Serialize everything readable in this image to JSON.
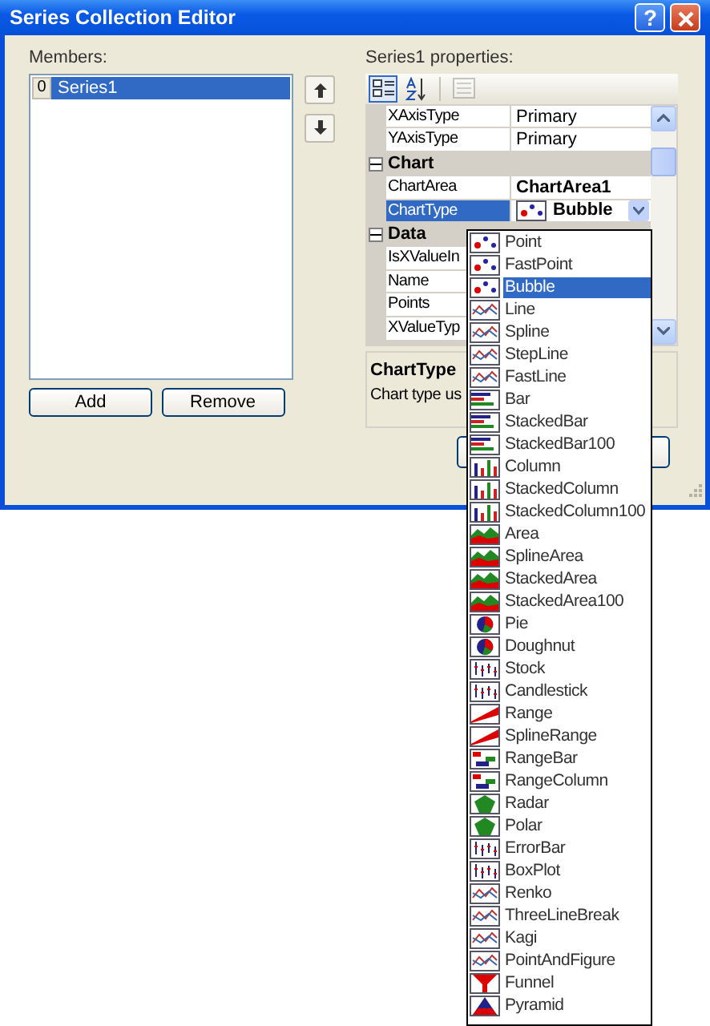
{
  "window": {
    "title": "Series Collection Editor",
    "help": "?"
  },
  "members": {
    "label": "Members:",
    "items": [
      {
        "index": "0",
        "name": "Series1",
        "selected": true
      }
    ],
    "add": "Add",
    "remove": "Remove"
  },
  "properties": {
    "label": "Series1 properties:",
    "toolbar": [
      {
        "kind": "categorized",
        "selected": true,
        "disabled": false
      },
      {
        "kind": "alphabetical",
        "selected": false,
        "disabled": false
      },
      {
        "kind": "pages",
        "selected": false,
        "disabled": true
      }
    ],
    "rows": [
      {
        "kind": "property",
        "name": "XAxisType",
        "value": "Primary",
        "selected": false,
        "modified": false
      },
      {
        "kind": "property",
        "name": "YAxisType",
        "value": "Primary",
        "selected": false,
        "modified": false
      },
      {
        "kind": "category",
        "name": "Chart",
        "expanded": true
      },
      {
        "kind": "property",
        "name": "ChartArea",
        "value": "ChartArea1",
        "selected": false,
        "modified": true
      },
      {
        "kind": "dropdown",
        "name": "ChartType",
        "value": "Bubble",
        "selected": true,
        "modified": true
      },
      {
        "kind": "category",
        "name": "Data",
        "expanded": true
      },
      {
        "kind": "property",
        "name": "IsXValueIn",
        "selected": false
      },
      {
        "kind": "property",
        "name": "Name",
        "selected": false
      },
      {
        "kind": "property",
        "name": "Points",
        "selected": false
      },
      {
        "kind": "property",
        "name": "XValueTyp",
        "selected": false
      }
    ],
    "description": {
      "title": "ChartType",
      "text": "Chart type us"
    }
  },
  "dropdown": {
    "items": [
      {
        "label": "Point",
        "selected": false
      },
      {
        "label": "FastPoint",
        "selected": false
      },
      {
        "label": "Bubble",
        "selected": true
      },
      {
        "label": "Line",
        "selected": false
      },
      {
        "label": "Spline",
        "selected": false
      },
      {
        "label": "StepLine",
        "selected": false
      },
      {
        "label": "FastLine",
        "selected": false
      },
      {
        "label": "Bar",
        "selected": false
      },
      {
        "label": "StackedBar",
        "selected": false
      },
      {
        "label": "StackedBar100",
        "selected": false
      },
      {
        "label": "Column",
        "selected": false
      },
      {
        "label": "StackedColumn",
        "selected": false
      },
      {
        "label": "StackedColumn100",
        "selected": false
      },
      {
        "label": "Area",
        "selected": false
      },
      {
        "label": "SplineArea",
        "selected": false
      },
      {
        "label": "StackedArea",
        "selected": false
      },
      {
        "label": "StackedArea100",
        "selected": false
      },
      {
        "label": "Pie",
        "selected": false
      },
      {
        "label": "Doughnut",
        "selected": false
      },
      {
        "label": "Stock",
        "selected": false
      },
      {
        "label": "Candlestick",
        "selected": false
      },
      {
        "label": "Range",
        "selected": false
      },
      {
        "label": "SplineRange",
        "selected": false
      },
      {
        "label": "RangeBar",
        "selected": false
      },
      {
        "label": "RangeColumn",
        "selected": false
      },
      {
        "label": "Radar",
        "selected": false
      },
      {
        "label": "Polar",
        "selected": false
      },
      {
        "label": "ErrorBar",
        "selected": false
      },
      {
        "label": "BoxPlot",
        "selected": false
      },
      {
        "label": "Renko",
        "selected": false
      },
      {
        "label": "ThreeLineBreak",
        "selected": false
      },
      {
        "label": "Kagi",
        "selected": false
      },
      {
        "label": "PointAndFigure",
        "selected": false
      },
      {
        "label": "Funnel",
        "selected": false
      },
      {
        "label": "Pyramid",
        "selected": false
      }
    ]
  }
}
